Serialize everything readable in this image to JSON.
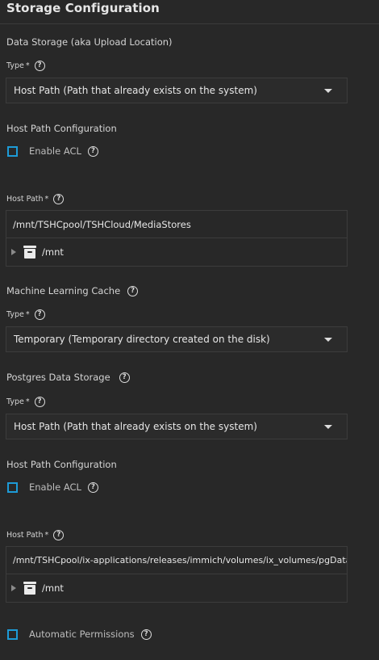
{
  "page": {
    "title": "Storage Configuration"
  },
  "data_storage": {
    "heading": "Data Storage (aka Upload Location)",
    "type_label": "Type",
    "required_mark": "*",
    "type_value": "Host Path (Path that already exists on the system)",
    "host_path_config_heading": "Host Path Configuration",
    "enable_acl_label": "Enable ACL",
    "enable_acl_checked": false,
    "host_path_label": "Host Path",
    "host_path_value": "/mnt/TSHCpool/TSHCloud/MediaStores",
    "tree_root": "/mnt"
  },
  "ml_cache": {
    "heading": "Machine Learning Cache",
    "type_label": "Type",
    "required_mark": "*",
    "type_value": "Temporary (Temporary directory created on the disk)"
  },
  "postgres": {
    "heading": "Postgres Data Storage",
    "type_label": "Type",
    "required_mark": "*",
    "type_value": "Host Path (Path that already exists on the system)",
    "host_path_config_heading": "Host Path Configuration",
    "enable_acl_label": "Enable ACL",
    "enable_acl_checked": false,
    "host_path_label": "Host Path",
    "host_path_value": "/mnt/TSHCpool/ix-applications/releases/immich/volumes/ix_volumes/pgData",
    "tree_root": "/mnt",
    "auto_permissions_label": "Automatic Permissions",
    "auto_permissions_checked": false
  },
  "icons": {
    "help": "help-circle-icon",
    "dropdown": "caret-down-icon",
    "expand": "expand-triangle-icon",
    "folder": "folder-icon"
  },
  "colors": {
    "background": "#282828",
    "checkbox": "#1d9bd7",
    "border": "#3c3c3c"
  }
}
